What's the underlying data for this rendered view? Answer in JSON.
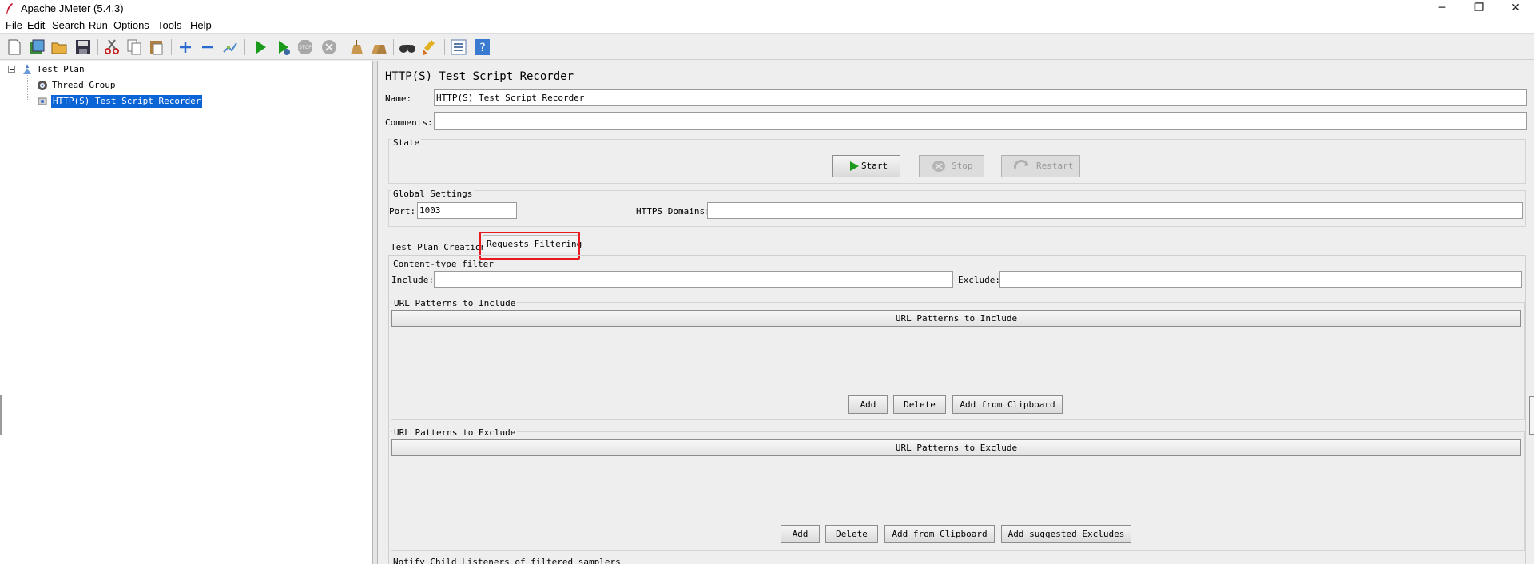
{
  "window": {
    "title": "Apache JMeter (5.4.3)"
  },
  "menu": [
    "File",
    "Edit",
    "Search",
    "Run",
    "Options",
    "Tools",
    "Help"
  ],
  "toolbar_icons": [
    "new-icon",
    "templates-icon",
    "open-icon",
    "save-icon",
    "cut-icon",
    "copy-icon",
    "paste-icon",
    "expand-icon",
    "collapse-icon",
    "toggle-icon",
    "start-icon",
    "start-no-pauses-icon",
    "stop-icon",
    "shutdown-icon",
    "clear-icon",
    "clear-all-icon",
    "search-icon",
    "reset-search-icon",
    "function-helper-icon",
    "help-icon"
  ],
  "tree": {
    "root": "Test Plan",
    "children": [
      "Thread Group",
      "HTTP(S) Test Script Recorder"
    ],
    "selected": "HTTP(S) Test Script Recorder"
  },
  "panel": {
    "title": "HTTP(S) Test Script Recorder",
    "name_label": "Name:",
    "name_value": "HTTP(S) Test Script Recorder",
    "comments_label": "Comments:",
    "comments_value": "",
    "state": {
      "legend": "State",
      "start": "Start",
      "stop": "Stop",
      "restart": "Restart"
    },
    "global": {
      "legend": "Global Settings",
      "port_label": "Port:",
      "port_value": "1003",
      "https_label": "HTTPS Domains:",
      "https_value": ""
    },
    "tabs": [
      "Test Plan Creation",
      "Requests Filtering"
    ],
    "active_tab": "Requests Filtering",
    "content_filter": {
      "legend": "Content-type filter",
      "include_label": "Include:",
      "exclude_label": "Exclude:"
    },
    "include_patterns": {
      "legend": "URL Patterns to Include",
      "column": "URL Patterns to Include",
      "buttons": [
        "Add",
        "Delete",
        "Add from Clipboard"
      ]
    },
    "exclude_patterns": {
      "legend": "URL Patterns to Exclude",
      "column": "URL Patterns to Exclude",
      "buttons": [
        "Add",
        "Delete",
        "Add from Clipboard",
        "Add suggested Excludes"
      ]
    },
    "notify_legend": "Notify Child Listeners of filtered samplers"
  },
  "colors": {
    "selection": "#0a64d6",
    "highlight": "#e8191c",
    "start_green": "#1a9a1a"
  }
}
